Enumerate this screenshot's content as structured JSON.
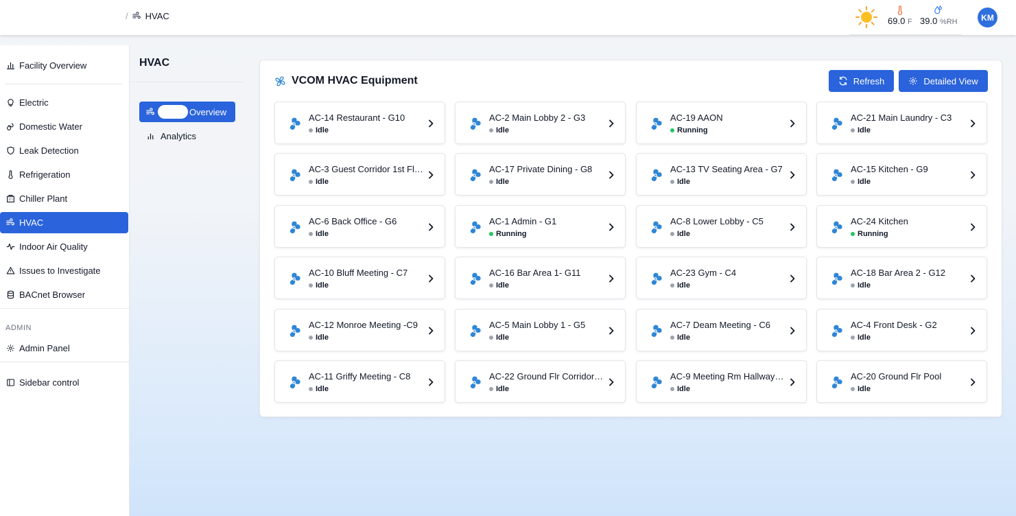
{
  "header": {
    "breadcrumb_sep": "/",
    "breadcrumb_page": "HVAC",
    "weather": {
      "temperature": "69.0",
      "temperature_unit": "F",
      "humidity": "39.0",
      "humidity_unit": "%RH"
    },
    "avatar_initials": "KM"
  },
  "sidebar": {
    "items": [
      {
        "label": "Facility Overview",
        "icon": "bar-chart-icon"
      },
      {
        "label": "Electric",
        "icon": "lightbulb-icon"
      },
      {
        "label": "Domestic Water",
        "icon": "water-drops-icon"
      },
      {
        "label": "Leak Detection",
        "icon": "shield-icon"
      },
      {
        "label": "Refrigeration",
        "icon": "thermometer-icon"
      },
      {
        "label": "Chiller Plant",
        "icon": "building-icon"
      },
      {
        "label": "HVAC",
        "icon": "wind-icon"
      },
      {
        "label": "Indoor Air Quality",
        "icon": "activity-icon"
      },
      {
        "label": "Issues to Investigate",
        "icon": "warning-icon"
      },
      {
        "label": "BACnet Browser",
        "icon": "database-icon"
      }
    ],
    "admin_section": "ADMIN",
    "admin_panel": "Admin Panel",
    "sidebar_control": "Sidebar control"
  },
  "subnav": {
    "title": "HVAC",
    "overview": "Overview",
    "analytics": "Analytics"
  },
  "main": {
    "title": "VCOM HVAC Equipment",
    "refresh_label": "Refresh",
    "detailed_view_label": "Detailed View",
    "equipment": [
      {
        "name": "AC-14 Restaurant - G10",
        "status": "Idle"
      },
      {
        "name": "AC-2 Main Lobby 2 - G3",
        "status": "Idle"
      },
      {
        "name": "AC-19 AAON",
        "status": "Running"
      },
      {
        "name": "AC-21 Main Laundry - C3",
        "status": "Idle"
      },
      {
        "name": "AC-3 Guest Corridor 1st Flr ...",
        "status": "Idle"
      },
      {
        "name": "AC-17 Private Dining - G8",
        "status": "Idle"
      },
      {
        "name": "AC-13 TV Seating Area - G7",
        "status": "Idle"
      },
      {
        "name": "AC-15 Kitchen - G9",
        "status": "Idle"
      },
      {
        "name": "AC-6 Back Office - G6",
        "status": "Idle"
      },
      {
        "name": "AC-1 Admin - G1",
        "status": "Running"
      },
      {
        "name": "AC-8 Lower Lobby - C5",
        "status": "Idle"
      },
      {
        "name": "AC-24 Kitchen",
        "status": "Running"
      },
      {
        "name": "AC-10 Bluff Meeting - C7",
        "status": "Idle"
      },
      {
        "name": "AC-16 Bar Area 1- G11",
        "status": "Idle"
      },
      {
        "name": "AC-23 Gym - C4",
        "status": "Idle"
      },
      {
        "name": "AC-18 Bar Area 2 - G12",
        "status": "Idle"
      },
      {
        "name": "AC-12 Monroe Meeting -C9",
        "status": "Idle"
      },
      {
        "name": "AC-5 Main Lobby 1 - G5",
        "status": "Idle"
      },
      {
        "name": "AC-7 Deam Meeting - C6",
        "status": "Idle"
      },
      {
        "name": "AC-4 Front Desk - G2",
        "status": "Idle"
      },
      {
        "name": "AC-11 Griffy Meeting - C8",
        "status": "Idle"
      },
      {
        "name": "AC-22 Ground Flr Corridor -...",
        "status": "Idle"
      },
      {
        "name": "AC-9 Meeting Rm Hallway -...",
        "status": "Idle"
      },
      {
        "name": "AC-20 Ground Flr Pool",
        "status": "Idle"
      }
    ]
  },
  "colors": {
    "primary": "#2a63db",
    "fan": "#2f86d6",
    "running": "#22c55e",
    "idle": "#9ca3af"
  }
}
